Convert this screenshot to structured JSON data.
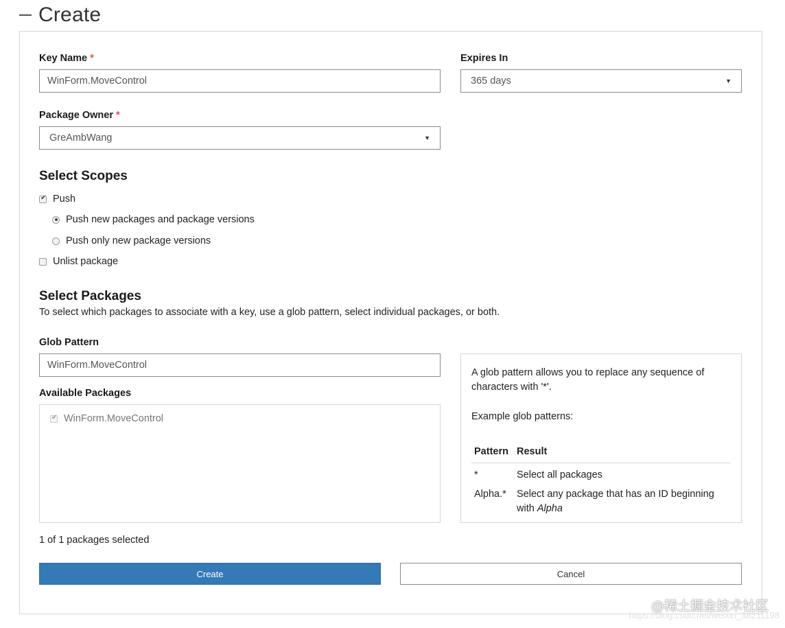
{
  "header": {
    "title": "Create"
  },
  "form": {
    "key_name": {
      "label": "Key Name",
      "required_mark": "*",
      "value": "WinForm.MoveControl"
    },
    "expires_in": {
      "label": "Expires In",
      "value": "365 days"
    },
    "package_owner": {
      "label": "Package Owner",
      "required_mark": "*",
      "value": "GreAmbWang"
    }
  },
  "scopes": {
    "title": "Select Scopes",
    "push": {
      "label": "Push",
      "checked": true
    },
    "push_new": {
      "label": "Push new packages and package versions",
      "selected": true
    },
    "push_only": {
      "label": "Push only new package versions",
      "selected": false
    },
    "unlist": {
      "label": "Unlist package",
      "checked": false
    }
  },
  "packages": {
    "title": "Select Packages",
    "description": "To select which packages to associate with a key, use a glob pattern, select individual packages, or both.",
    "glob_label": "Glob Pattern",
    "glob_value": "WinForm.MoveControl",
    "available_label": "Available Packages",
    "items": [
      {
        "name": "WinForm.MoveControl",
        "checked": true
      }
    ],
    "selected_count": "1 of 1 packages selected"
  },
  "help": {
    "intro": "A glob pattern allows you to replace any sequence of characters with '*'.",
    "examples_label": "Example glob patterns:",
    "table_headers": [
      "Pattern",
      "Result"
    ],
    "rows": [
      {
        "pattern": "*",
        "result": "Select all packages"
      },
      {
        "pattern": "Alpha.*",
        "result_prefix": "Select any package that has an ID beginning with ",
        "result_emphasis": "Alpha"
      }
    ]
  },
  "buttons": {
    "create": "Create",
    "cancel": "Cancel"
  },
  "watermark": {
    "line1": "@稀土掘金技术社区",
    "line2": "https://blog.csdn.net/weixin_38211198"
  }
}
